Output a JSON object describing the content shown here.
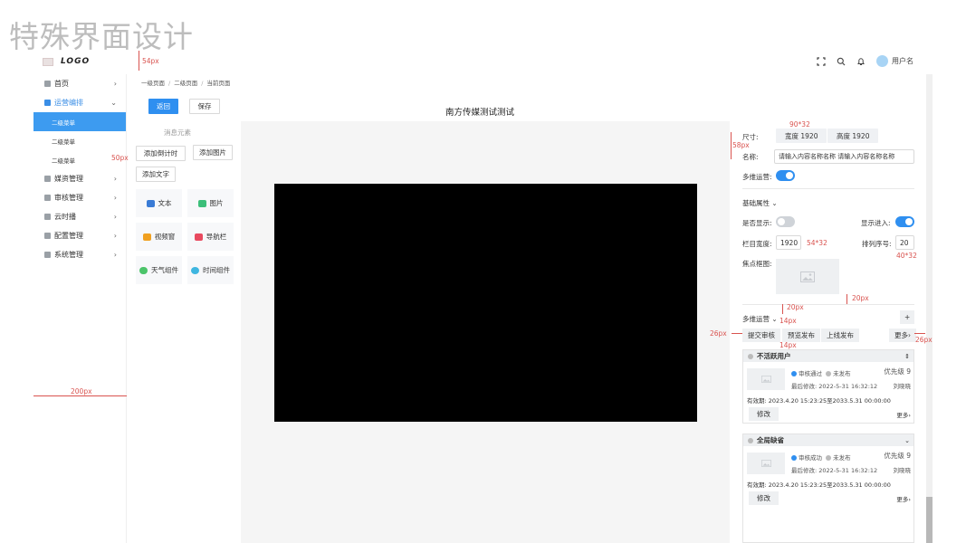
{
  "page_title": "特殊界面设计",
  "header": {
    "logo_text": "LOGO",
    "user_name": "用户名"
  },
  "sidebar": {
    "items": [
      {
        "label": "首页",
        "chevron": "›"
      },
      {
        "label": "运营编排",
        "chevron": "⌄",
        "active": true
      },
      {
        "label": "媒资管理",
        "chevron": "›"
      },
      {
        "label": "审核管理",
        "chevron": "›"
      },
      {
        "label": "云时播",
        "chevron": "›"
      },
      {
        "label": "配置管理",
        "chevron": "›"
      },
      {
        "label": "系统管理",
        "chevron": "›"
      }
    ],
    "sub_items": [
      "二级菜单",
      "二级菜单",
      "二级菜单"
    ]
  },
  "breadcrumb": [
    "一级页面",
    "二级页面",
    "当前页面"
  ],
  "toolbar": {
    "back_label": "返回",
    "save_label": "保存"
  },
  "tools": {
    "section_label": "消息元素",
    "add_countdown": "添加倒计时",
    "add_image": "添加图片",
    "add_text": "添加文字",
    "components": [
      "文本",
      "图片",
      "视频窗",
      "导航栏",
      "天气组件",
      "时间组件"
    ]
  },
  "canvas": {
    "title": "南方传媒测试测试"
  },
  "props": {
    "size_label": "尺寸:",
    "width_tag": "宽度 1920",
    "height_tag": "高度 1920",
    "name_label": "名称:",
    "name_value": "请输入内容名称名称 请输入内容名称名称",
    "multi_op_label": "多维运营:",
    "basic_attr": "基础属性",
    "is_show_label": "是否显示:",
    "show_enter_label": "显示进入:",
    "col_width_label": "栏目宽度:",
    "col_width_value": "1920",
    "order_label": "排列序号:",
    "order_value": "20",
    "focus_label": "焦点框图:",
    "multi_section": "多维运营",
    "add_symbol": "+",
    "action_submit": "提交审核",
    "action_preview": "预览发布",
    "action_online": "上线发布",
    "action_more": "更多",
    "cards": [
      {
        "title": "不活跃用户",
        "status1": "审核通过",
        "status2": "未发布",
        "priority": "优先级 9",
        "modified": "最后修改: 2022-5-31 16:32:12",
        "author": "刘晓晓",
        "validity": "有效期: 2023.4.20 15:23:25至2033.5.31 00:00:00",
        "edit": "修改",
        "more": "更多"
      },
      {
        "title": "全局缺省",
        "status1": "审核成功",
        "status2": "未发布",
        "priority": "优先级 9",
        "modified": "最后修改: 2022-5-31 16:32:12",
        "author": "刘晓晓",
        "validity": "有效期: 2023.4.20 15:23:25至2033.5.31 00:00:00",
        "edit": "修改",
        "more": "更多"
      }
    ]
  },
  "annotations": {
    "a54": "54px",
    "a50": "50px",
    "a200": "200px",
    "a90": "90*32",
    "a58": "58px",
    "a54_32": "54*32",
    "a40_32": "40*32",
    "a20a": "20px",
    "a20b": "20px",
    "a14a": "14px",
    "a14b": "14px",
    "a26a": "26px",
    "a26b": "26px"
  },
  "colors": {
    "primary": "#2f8ff0",
    "annotation": "#d9534f",
    "canvas_screen": "#000000"
  }
}
